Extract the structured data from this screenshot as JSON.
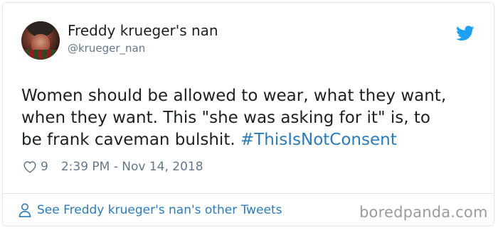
{
  "tweet": {
    "author_name": "Freddy krueger's nan",
    "author_handle": "@krueger_nan",
    "text_lines": [
      "Women should be allowed to wear, what they want,",
      "when they want. This \"she was asking for it\" is, to",
      "be frank caveman bulshit. "
    ],
    "hashtag": "#ThisIsNotConsent",
    "like_count": "9",
    "timestamp": "2:39 PM - Nov 14, 2018",
    "see_more_link": "See Freddy krueger's nan's other Tweets"
  },
  "watermark": "boredpanda.com",
  "icons": {
    "avatar": "avatar",
    "twitter": "twitter-bird-icon",
    "like": "heart-icon",
    "profile": "person-icon"
  },
  "colors": {
    "twitter_blue": "#1da1f2",
    "link_blue": "#2b7bb9",
    "muted_text": "#657786",
    "body_text": "#1c2022",
    "border": "#e1e8ed"
  }
}
